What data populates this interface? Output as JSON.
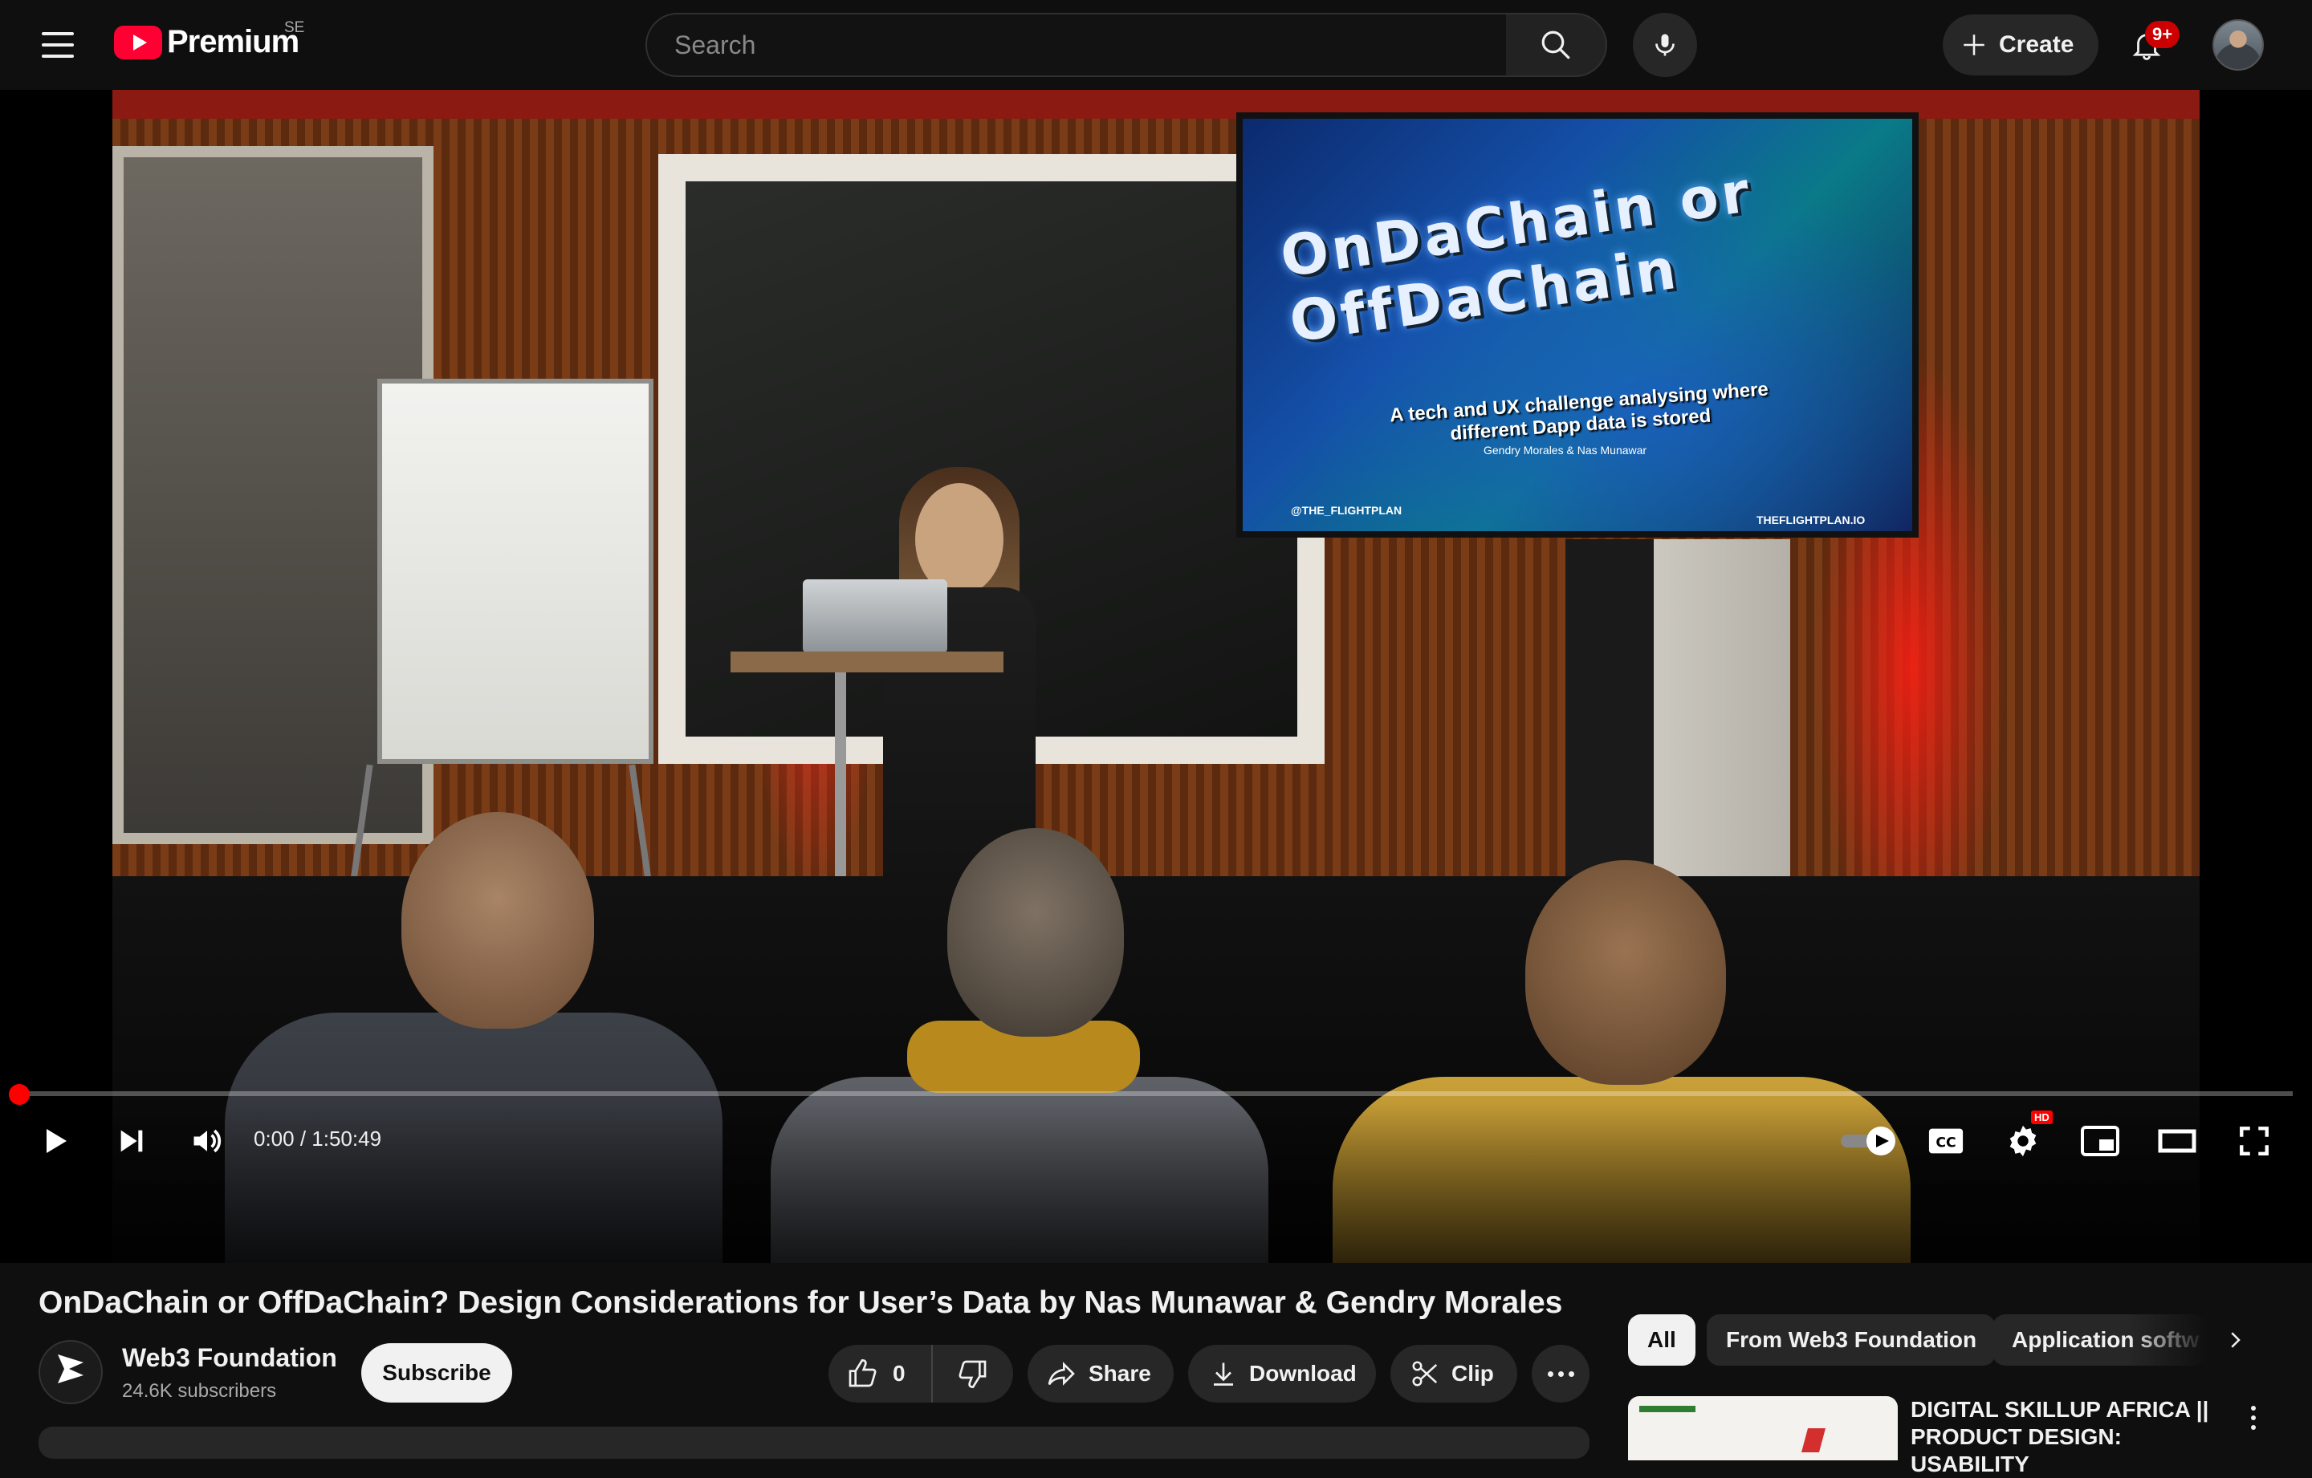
{
  "masthead": {
    "logo_text": "Premium",
    "region": "SE",
    "search_placeholder": "Search",
    "create_label": "Create",
    "notification_count": "9+"
  },
  "player": {
    "slide": {
      "title": "OnDaChain or OffDaChain",
      "subtitle": "A tech and UX challenge analysing where different Dapp data is stored",
      "names": "Gendry Morales & Nas Munawar",
      "handle": "@THE_FLIGHTPLAN",
      "site": "THEFLIGHTPLAN.IO"
    },
    "time_current": "0:00",
    "time_separator": " / ",
    "time_total": "1:50:49",
    "progress": 0,
    "hd_label": "HD"
  },
  "video": {
    "title": "OnDaChain or OffDaChain? Design Considerations for User’s Data by Nas Munawar & Gendry Morales",
    "channel_name": "Web3 Foundation",
    "subscribers": "24.6K subscribers",
    "subscribe_label": "Subscribe",
    "like_count": "0",
    "share_label": "Share",
    "download_label": "Download",
    "clip_label": "Clip"
  },
  "sidebar": {
    "chips": [
      "All",
      "From Web3 Foundation",
      "Application softw"
    ],
    "recommendation": {
      "title": "DIGITAL SKILLUP AFRICA || PRODUCT DESIGN: USABILITY"
    }
  },
  "colors": {
    "accent": "#ff0000",
    "background": "#0f0f0f",
    "surface": "#272727"
  }
}
